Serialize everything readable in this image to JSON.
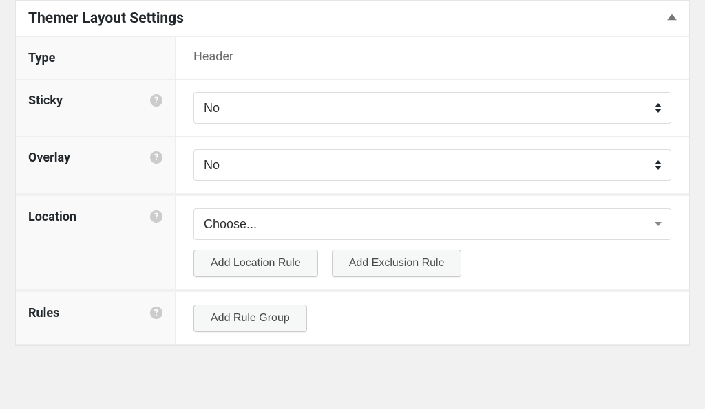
{
  "panel": {
    "title": "Themer Layout Settings"
  },
  "rows": {
    "type": {
      "label": "Type",
      "value": "Header"
    },
    "sticky": {
      "label": "Sticky",
      "value": "No"
    },
    "overlay": {
      "label": "Overlay",
      "value": "No"
    },
    "location": {
      "label": "Location",
      "value": "Choose...",
      "add_location_rule": "Add Location Rule",
      "add_exclusion_rule": "Add Exclusion Rule"
    },
    "rules": {
      "label": "Rules",
      "add_rule_group": "Add Rule Group"
    }
  }
}
